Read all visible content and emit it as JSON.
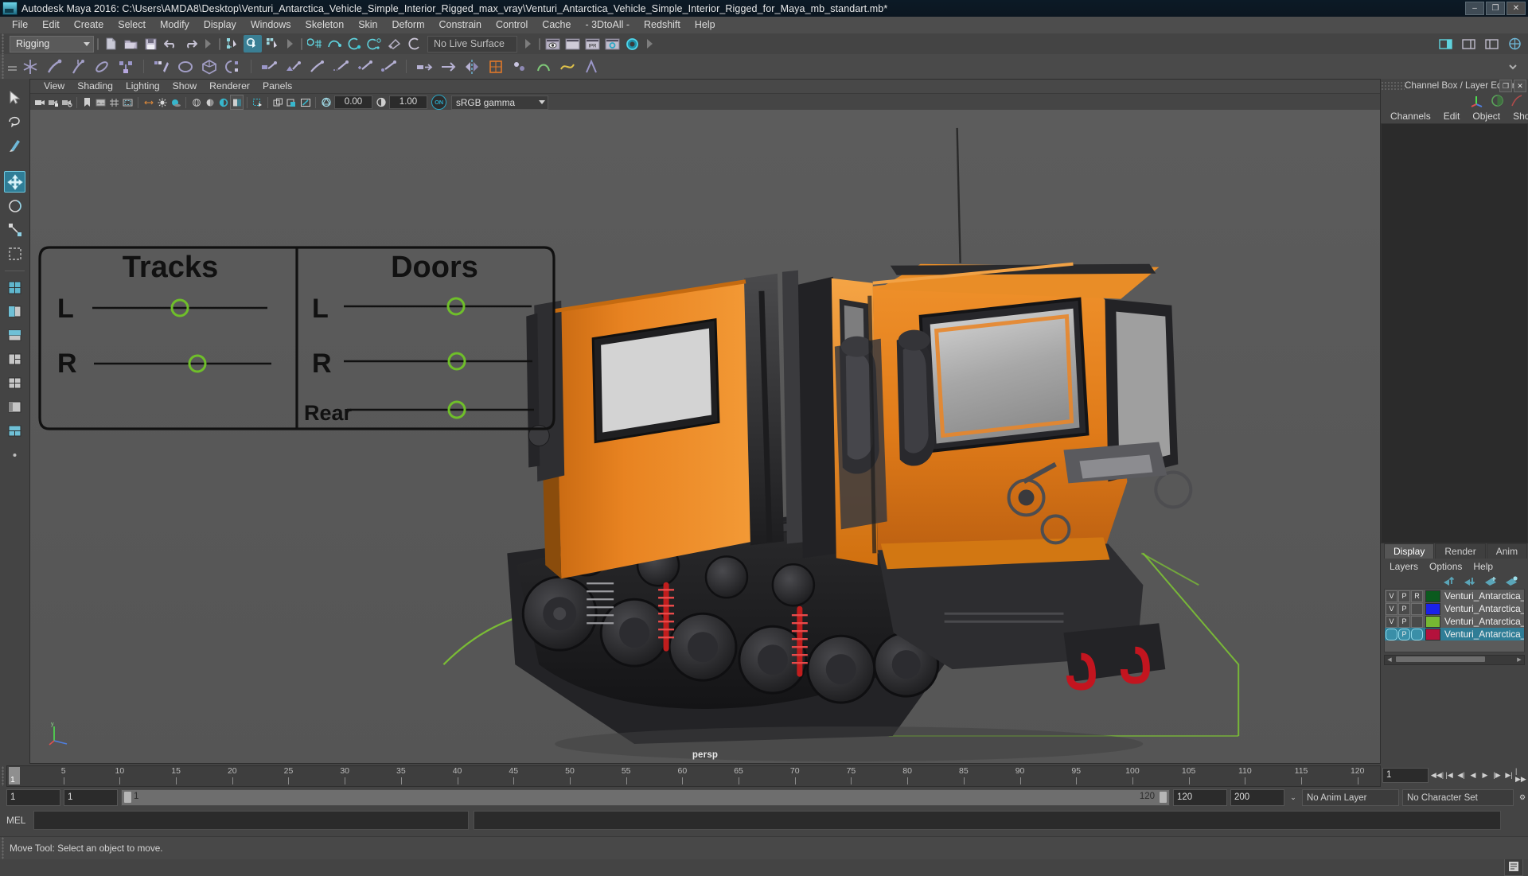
{
  "window": {
    "title": "Autodesk Maya 2016: C:\\Users\\AMDA8\\Desktop\\Venturi_Antarctica_Vehicle_Simple_Interior_Rigged_max_vray\\Venturi_Antarctica_Vehicle_Simple_Interior_Rigged_for_Maya_mb_standart.mb*",
    "minimize": "–",
    "maximize": "❐",
    "close": "✕"
  },
  "menubar": {
    "items": [
      "File",
      "Edit",
      "Create",
      "Select",
      "Modify",
      "Display",
      "Windows",
      "Skeleton",
      "Skin",
      "Deform",
      "Constrain",
      "Control",
      "Cache",
      "- 3DtoAll -",
      "Redshift",
      "Help"
    ]
  },
  "toolbar": {
    "mode_selector": "Rigging",
    "live_surface": "No Live Surface",
    "ipr_label": "IPR"
  },
  "viewport": {
    "menu": [
      "View",
      "Shading",
      "Lighting",
      "Show",
      "Renderer",
      "Panels"
    ],
    "exposure_value": "0.00",
    "gamma_value": "1.00",
    "color_mgmt_toggle": "ON",
    "color_profile": "sRGB gamma",
    "camera_label": "persp"
  },
  "control_panel": {
    "tracks": {
      "title": "Tracks",
      "rows": [
        {
          "label": "L",
          "handle_color": "#6fbf2a"
        },
        {
          "label": "R",
          "handle_color": "#6fbf2a"
        }
      ]
    },
    "doors": {
      "title": "Doors",
      "rows": [
        {
          "label": "L",
          "handle_color": "#6fbf2a"
        },
        {
          "label": "R",
          "handle_color": "#6fbf2a"
        },
        {
          "label": "Rear",
          "handle_color": "#6fbf2a"
        }
      ]
    }
  },
  "right_panel": {
    "title": "Channel Box / Layer Editor",
    "menu": [
      "Channels",
      "Edit",
      "Object",
      "Show"
    ],
    "restore": "❐",
    "close": "✕"
  },
  "layer_editor": {
    "tabs": [
      "Display",
      "Render",
      "Anim"
    ],
    "active_tab": "Display",
    "menu": [
      "Layers",
      "Options",
      "Help"
    ],
    "columns": [
      "V",
      "P",
      "R"
    ],
    "layers": [
      {
        "v": "V",
        "p": "P",
        "r": "R",
        "color": "#0b5a1e",
        "name": "Venturi_Antarctica_Vehicle_Si",
        "selected": false
      },
      {
        "v": "V",
        "p": "P",
        "r": "",
        "color": "#1a22e8",
        "name": "Venturi_Antarctica_Vehicle_Si",
        "selected": false
      },
      {
        "v": "V",
        "p": "P",
        "r": "",
        "color": "#76b832",
        "name": "Venturi_Antarctica_Vehicle_Si",
        "selected": false
      },
      {
        "v": "",
        "p": "P",
        "r": "",
        "color": "#b4123c",
        "name": "Venturi_Antarctica_Veh",
        "selected": true
      }
    ]
  },
  "timeline": {
    "ticks": [
      5,
      10,
      15,
      20,
      25,
      30,
      35,
      40,
      45,
      50,
      55,
      60,
      65,
      70,
      75,
      80,
      85,
      90,
      95,
      100,
      105,
      110,
      115,
      120
    ],
    "current_frame": "1",
    "current_frame_field": "1",
    "range_start_field": "1",
    "range_start_2": "1",
    "range_bar_start": "1",
    "range_bar_end": "120",
    "end_field": "120",
    "max_field": "200",
    "anim_layer": "No Anim Layer",
    "character_set": "No Character Set"
  },
  "command_line": {
    "language": "MEL",
    "input_value": "",
    "output_value": ""
  },
  "status": {
    "message": "Move Tool: Select an object to move."
  },
  "colors": {
    "accent_blue": "#2f7d96",
    "cyan": "#3bbcd6",
    "shelf_purple": "#9a96c8",
    "green_handle": "#6fbf2a",
    "grid_green": "#7ec832",
    "body_orange": "#e07b1a"
  }
}
